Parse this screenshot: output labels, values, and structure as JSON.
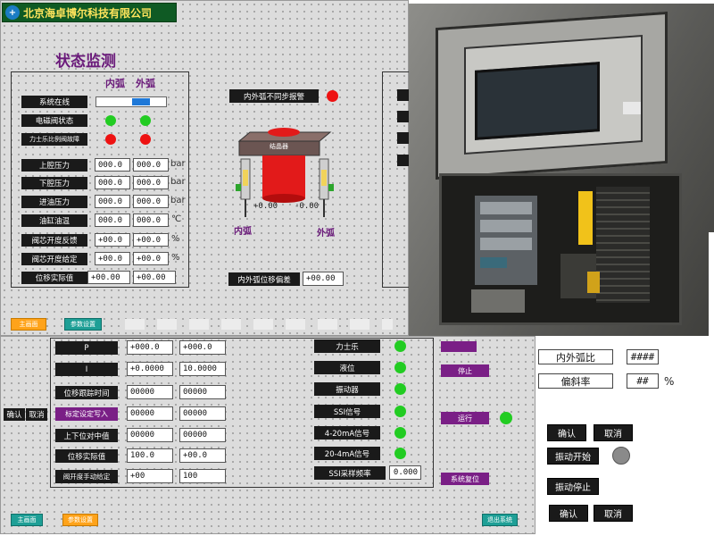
{
  "header": {
    "company": "北京海卓博尔科技有限公司"
  },
  "status": {
    "title": "状态监测",
    "col_inner": "内弧",
    "col_outer": "外弧",
    "rows_indicators": [
      {
        "label": "系统在线"
      },
      {
        "label": "电磁阀状态"
      },
      {
        "label": "力士乐比例阀故障"
      }
    ],
    "pressure_rows": [
      {
        "label": "上腔压力",
        "inner": "000.0",
        "outer": "000.0",
        "unit": "bar"
      },
      {
        "label": "下腔压力",
        "inner": "000.0",
        "outer": "000.0",
        "unit": "bar"
      },
      {
        "label": "进油压力",
        "inner": "000.0",
        "outer": "000.0",
        "unit": "bar"
      },
      {
        "label": "油缸油温",
        "inner": "000.0",
        "outer": "000.0",
        "unit": "℃"
      },
      {
        "label": "阀芯开度反馈",
        "inner": "+00.0",
        "outer": "+00.0",
        "unit": "%"
      },
      {
        "label": "阀芯开度给定",
        "inner": "+00.0",
        "outer": "+00.0",
        "unit": "%"
      },
      {
        "label": "位移实际值",
        "inner": "+00.00",
        "outer": "+00.00",
        "unit": ""
      }
    ],
    "sync_label": "内外弧不同步报警",
    "center_label": "结晶器",
    "inner_label": "内弧",
    "outer_label": "外弧",
    "inner_reading": "+0.00",
    "outer_reading": "-0.00",
    "offset_label": "内外弧位移偏差",
    "offset_value": "+00.00"
  },
  "nav": {
    "main_btn": "主画面",
    "param_btn": "参数设置"
  },
  "params": {
    "rows": [
      {
        "label": "P",
        "v1": "+000.0",
        "v2": "+000.0"
      },
      {
        "label": "I",
        "v1": "+0.0000",
        "v2": "10.0000"
      },
      {
        "label": "位移跟踪时间",
        "v1": "00000",
        "v2": "00000"
      },
      {
        "label": "标定设定写入",
        "v1": "00000",
        "v2": "00000"
      },
      {
        "label": "上下位对中值",
        "v1": "00000",
        "v2": "00000"
      },
      {
        "label": "位移实际值",
        "v1": "100.0",
        "v2": "+00.0"
      },
      {
        "label": "阀开度手动给定",
        "v1": "+00",
        "v2": "100"
      }
    ],
    "confirm": "确认",
    "cancel": "取消"
  },
  "signals": {
    "rows": [
      {
        "label": "力士乐"
      },
      {
        "label": "液位"
      },
      {
        "label": "振动器"
      },
      {
        "label": "SSI信号"
      },
      {
        "label": "4-20mA信号"
      },
      {
        "label": "20-4mA信号"
      }
    ],
    "ssi_freq_label": "SSI采样频率",
    "ssi_freq_value": "0.000"
  },
  "control": {
    "stop": "停止",
    "run": "运行",
    "reset": "系统复位"
  },
  "ratio": {
    "ratio_label": "内外弧比",
    "ratio_value": "####",
    "skew_label": "偏斜率",
    "skew_value": "##",
    "skew_unit": "%",
    "confirm": "确认",
    "cancel": "取消",
    "start": "振动开始",
    "stop": "振动停止",
    "confirm2": "确认",
    "cancel2": "取消"
  },
  "footer": {
    "b1": "主画面",
    "b2": "参数设置",
    "b3": "退出系统"
  },
  "colors": {
    "accent_purple": "#7a1f86",
    "green": "#22cc22",
    "red": "#ee1111"
  }
}
